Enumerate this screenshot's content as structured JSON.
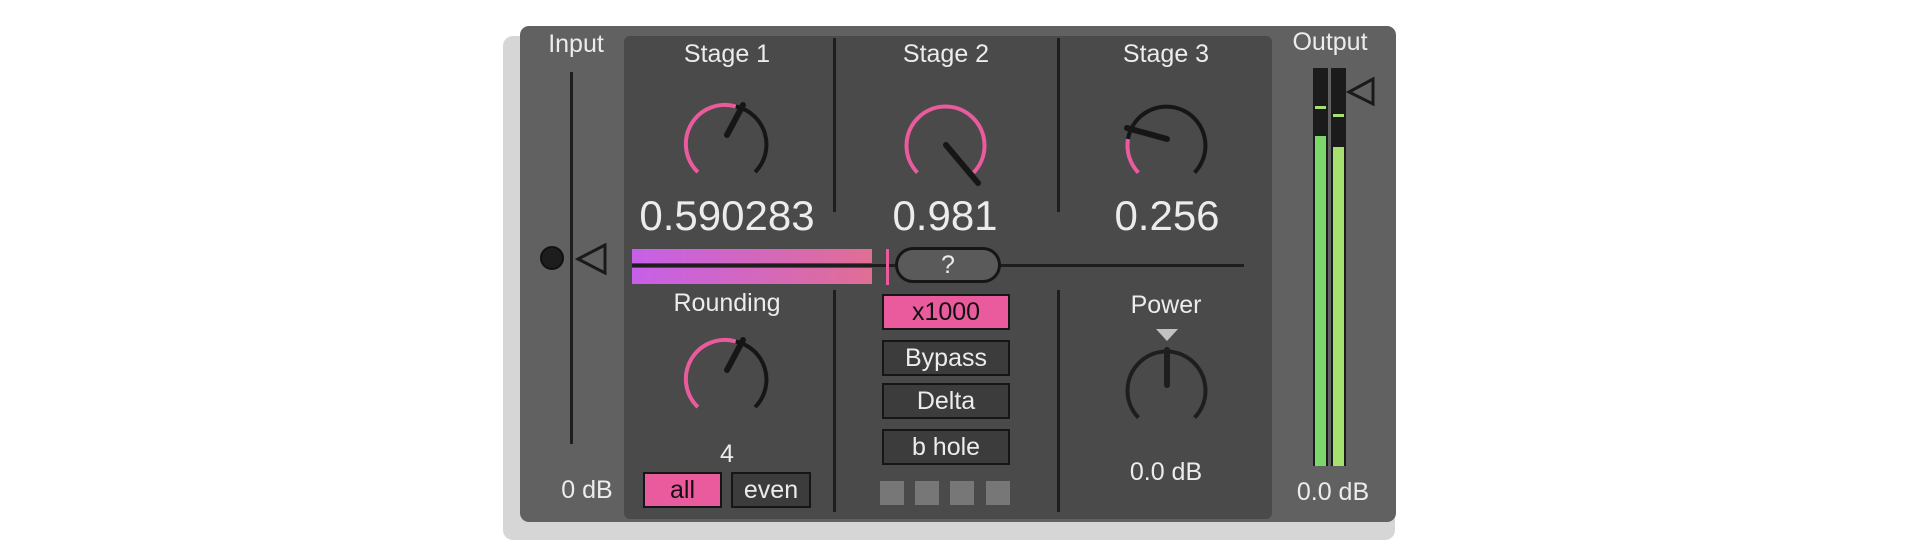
{
  "input": {
    "label": "Input",
    "level": "0 dB"
  },
  "output": {
    "label": "Output",
    "level": "0.0 dB"
  },
  "stages": [
    {
      "label": "Stage 1",
      "value": "0.590283"
    },
    {
      "label": "Stage 2",
      "value": "0.981"
    },
    {
      "label": "Stage 3",
      "value": "0.256"
    }
  ],
  "help_button": "?",
  "rounding": {
    "label": "Rounding",
    "value": "4",
    "modes": [
      "all",
      "even"
    ],
    "selected": "all"
  },
  "stage2_buttons": {
    "multiplier": "x1000",
    "bypass": "Bypass",
    "delta": "Delta",
    "bhole": "b hole"
  },
  "power": {
    "label": "Power",
    "value": "0.0 dB"
  },
  "colors": {
    "accent": "#ea5b9d",
    "meter": "#7dd86b",
    "slider_gradient": [
      "#c660e8",
      "#e06e95"
    ]
  },
  "icons": {
    "input_marker": "triangle-left-icon",
    "output_marker": "triangle-left-icon",
    "power_marker": "triangle-down-icon"
  }
}
